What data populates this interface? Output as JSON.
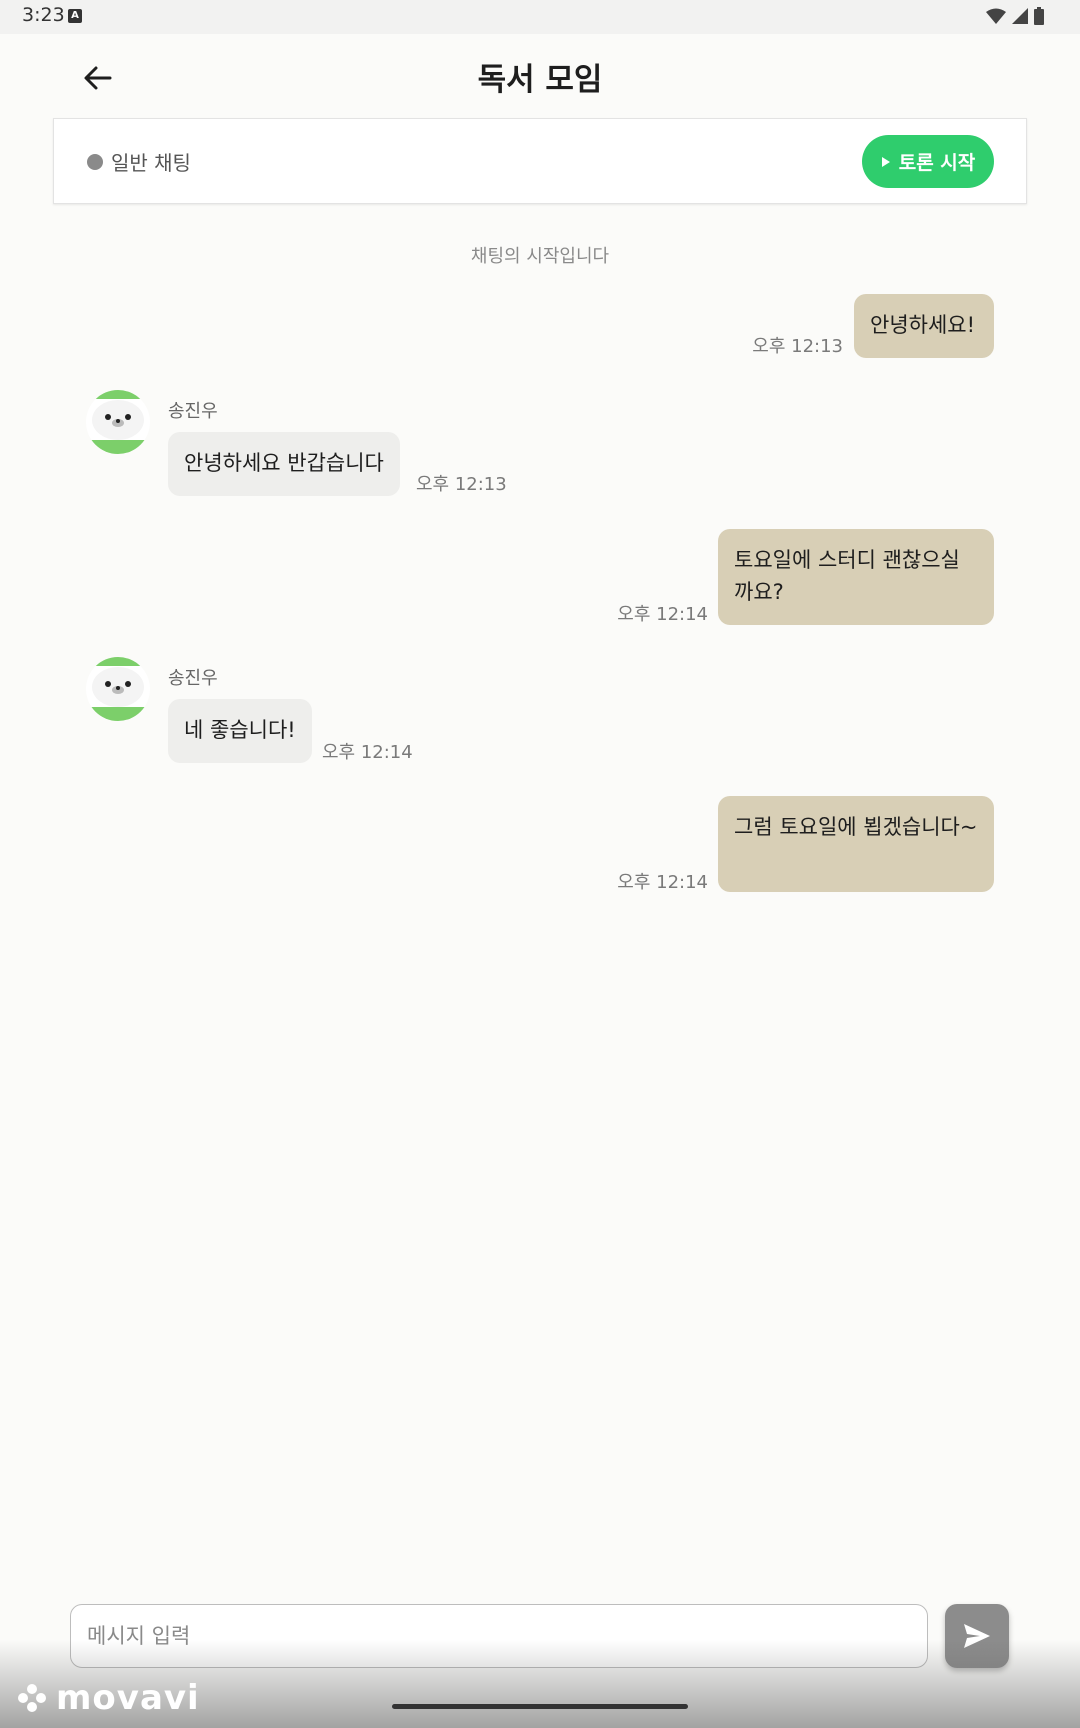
{
  "status_bar": {
    "time": "3:23",
    "notification_icon": "a-box-icon",
    "icons": [
      "wifi-icon",
      "signal-icon",
      "battery-icon"
    ]
  },
  "header": {
    "title": "독서 모임",
    "back_icon": "arrow-left-icon"
  },
  "mode": {
    "label": "일반 채팅",
    "start_button": "토론 시작",
    "start_color": "#2fcd6d"
  },
  "chat": {
    "start_notice": "채팅의 시작입니다",
    "messages": [
      {
        "direction": "out",
        "text": "안녕하세요!",
        "time": "오후 12:13"
      },
      {
        "direction": "in",
        "sender": "송진우",
        "text": "안녕하세요 반갑습니다",
        "time": "오후 12:13"
      },
      {
        "direction": "out",
        "text": "토요일에 스터디 괜찮으실까요?",
        "time": "오후 12:14"
      },
      {
        "direction": "in",
        "sender": "송진우",
        "text": "네 좋습니다!",
        "time": "오후 12:14"
      },
      {
        "direction": "out",
        "text": "그럼 토요일에 뵙겠습니다~",
        "time": "오후 12:14"
      }
    ]
  },
  "composer": {
    "placeholder": "메시지 입력",
    "value": "",
    "send_icon": "send-icon"
  },
  "watermark": {
    "text": "movavi"
  },
  "colors": {
    "outgoing_bubble": "#d8cfb6",
    "incoming_bubble": "#eeeeec",
    "background": "#fbfbf9"
  }
}
